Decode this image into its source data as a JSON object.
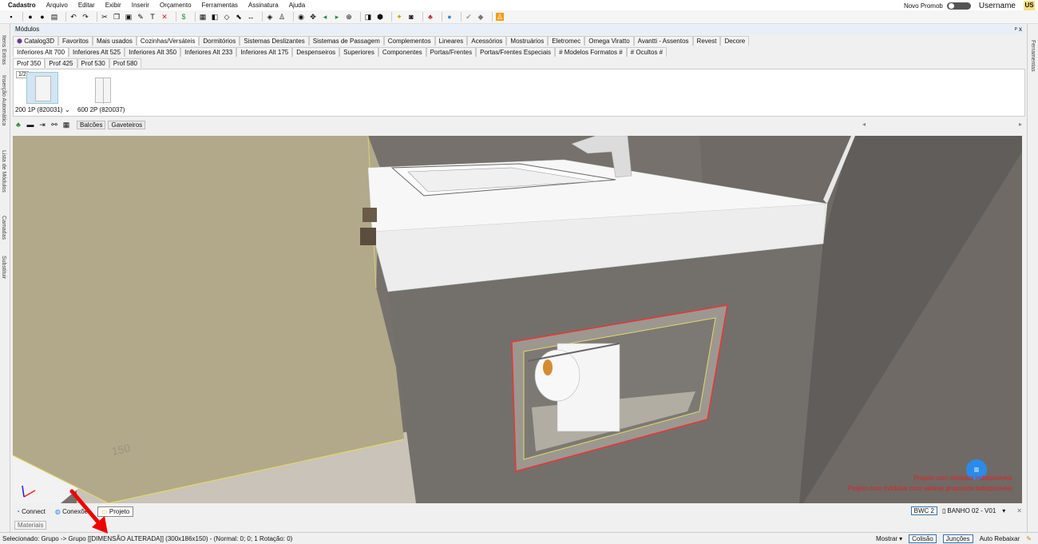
{
  "menu": {
    "items": [
      "Cadastro",
      "Arquivo",
      "Editar",
      "Exibir",
      "Inserir",
      "Orçamento",
      "Ferramentas",
      "Assinatura",
      "Ajuda"
    ],
    "promob_label": "Novo Promob",
    "username": "Username",
    "avatar_initials": "US"
  },
  "side_left": [
    "Itens Extras",
    "Inserção Automática",
    "Lista de Módulos",
    "Camadas",
    "Substituir"
  ],
  "side_right": [
    "Ferramentas"
  ],
  "modules": {
    "title": "Módulos",
    "pin_label": "ᵖ x",
    "tabs_row1": [
      "Catalog3D",
      "Favoritos",
      "Mais usados",
      "Cozinhas/Versáteis",
      "Dormitórios",
      "Sistemas Deslizantes",
      "Sistemas de Passagem",
      "Complementos",
      "Lineares",
      "Acessórios",
      "Mostruários",
      "Eletromec",
      "Omega Viratto",
      "Avantti - Assentos",
      "Revest",
      "Decore"
    ],
    "tabs_row2": [
      "Inferiores Alt 700",
      "Inferiores Alt 525",
      "Inferiores Alt 350",
      "Inferiores Alt 233",
      "Inferiores Alt 175",
      "Despenseiros",
      "Superiores",
      "Componentes",
      "Portas/Frentes",
      "Portas/Frentes Especiais",
      "# Modelos Formatos #",
      "# Ocultos #"
    ],
    "tabs_row3": [
      "Prof 350",
      "Prof 425",
      "Prof 530",
      "Prof 580"
    ],
    "page_badge": "1/2",
    "items": [
      {
        "label": "200 1P (820031)"
      },
      {
        "label": "600 2P (820037)"
      }
    ]
  },
  "viewbar": {
    "tabs": [
      "Balcões",
      "Gaveteiros"
    ],
    "arrow_left": "◂",
    "arrow_right": "▸"
  },
  "viewport": {
    "dimension_label": "150",
    "warnings": [
      "Projeto com módulos indisponíveis",
      "Projeto com módulos com valores propostos indisponíveis"
    ]
  },
  "bottom_tabs": [
    "Connect",
    "Conexões",
    "Projeto"
  ],
  "project": {
    "bwc": "BWC 2",
    "name": "BANHO 02 - V01"
  },
  "materials_label": "Materiais",
  "status": {
    "text": "Selecionado: Grupo -> Grupo [[DIMENSÃO ALTERADA]] (300x186x150) - (Normal: 0; 0; 1 Rotação: 0)",
    "mostrar": "Mostrar",
    "colisao": "Colisão",
    "juncoes": "Junções",
    "auto_rebaixar": "Auto Rebaixar"
  },
  "colors": {
    "wall_tan": "#b1a98a",
    "wall_gray": "#76716c",
    "countertop": "#f7f7f7",
    "warning_red": "#e02020",
    "chat_blue": "#2c8ae8"
  }
}
